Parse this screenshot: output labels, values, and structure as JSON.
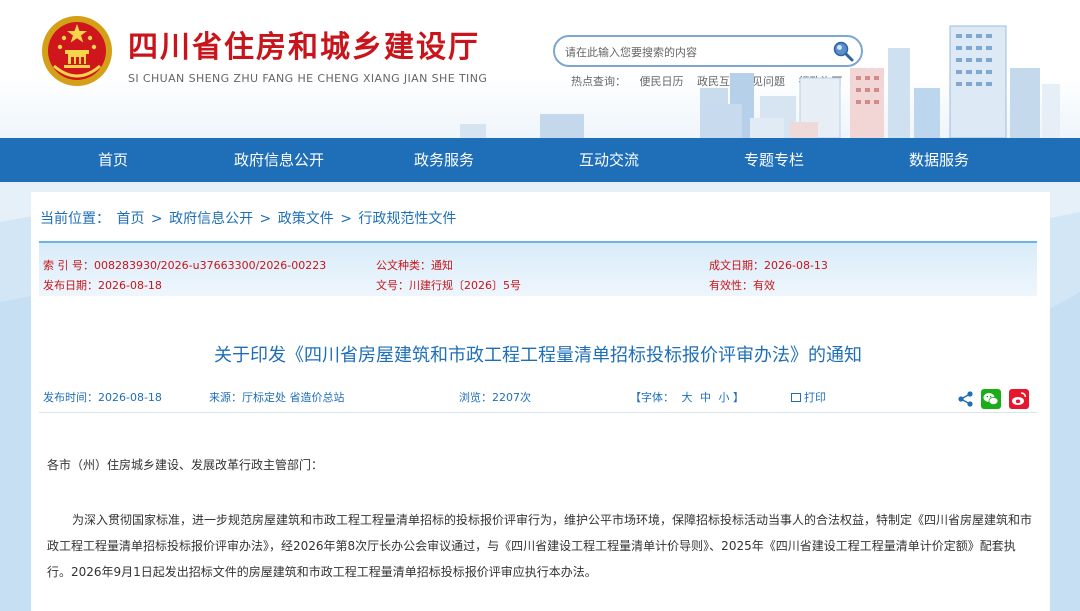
{
  "header": {
    "title": "四川省住房和城乡建设厅",
    "pinyin": "SI CHUAN SHENG ZHU FANG HE CHENG XIANG JIAN SHE TING",
    "search_placeholder": "请在此输入您要搜索的内容",
    "hot_search_label": "热点查询：",
    "hot_links": [
      "便民日历",
      "政民互动常见问题",
      "行政许可"
    ]
  },
  "nav": {
    "items": [
      "首页",
      "政府信息公开",
      "政务服务",
      "互动交流",
      "专题专栏",
      "数据服务"
    ]
  },
  "breadcrumb": {
    "label": "当前位置：",
    "items": [
      "首页",
      "政府信息公开",
      "政策文件",
      "行政规范性文件"
    ],
    "separator": ">"
  },
  "meta": {
    "index_no": "索 引 号：008283930/2026-u37663300/2026-00223",
    "category": "公文种类：通知",
    "created": "成文日期：2026-08-13",
    "published": "发布日期：2026-08-18",
    "doc_no": "文号：川建行规〔2026〕5号",
    "validity": "有效性：有效"
  },
  "article": {
    "title": "关于印发《四川省房屋建筑和市政工程工程量清单招标投标报价评审办法》的通知",
    "publish_time": "发布时间：2026-08-18",
    "source": "来源：厅标定处 省造价总站",
    "views": "浏览：2207次",
    "font_label": "【字体：",
    "font_sizes": [
      "大",
      "中",
      "小"
    ],
    "font_close": "】",
    "print_label": "打印",
    "salutation": "各市（州）住房城乡建设、发展改革行政主管部门：",
    "body1": "为深入贯彻国家标准，进一步规范房屋建筑和市政工程工程量清单招标的投标报价评审行为，维护公平市场环境，保障招标投标活动当事人的合法权益，特制定《四川省房屋建筑和市政工程工程量清单招标投标报价评审办法》，经2026年第8次厅长办公会审议通过，与《四川省建设工程工程量清单计价导则》、2025年《四川省建设工程工程量清单计价定额》配套执行。2026年9月1日起发出招标文件的房屋建筑和市政工程工程量清单招标投标报价评审应执行本办法。"
  },
  "colors": {
    "brand_red": "#c8141a",
    "nav_blue": "#1f6fb8",
    "wechat_green": "#1aad19",
    "weibo_red": "#e6162d"
  }
}
